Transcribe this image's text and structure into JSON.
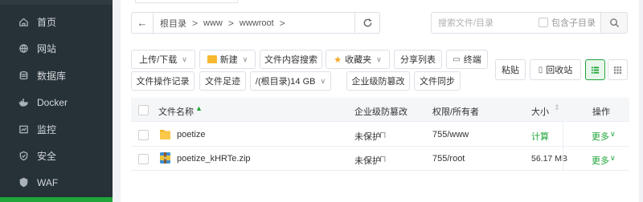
{
  "sidebar": {
    "items": [
      {
        "label": "首页",
        "icon": "home-icon"
      },
      {
        "label": "网站",
        "icon": "globe-icon"
      },
      {
        "label": "数据库",
        "icon": "database-icon"
      },
      {
        "label": "Docker",
        "icon": "docker-icon"
      },
      {
        "label": "监控",
        "icon": "monitor-icon"
      },
      {
        "label": "安全",
        "icon": "shield-icon"
      },
      {
        "label": "WAF",
        "icon": "waf-icon"
      }
    ],
    "active_color": "#20a53a",
    "bg_color": "#263238"
  },
  "pathbar": {
    "back": "←",
    "crumbs": [
      "根目录",
      "www",
      "wwwroot"
    ],
    "sep": ">"
  },
  "search": {
    "placeholder": "搜索文件/目录",
    "subdir_label": "包含子目录"
  },
  "toolbar": {
    "upload": "上传/下载",
    "new": "新建",
    "content_search": "文件内容搜索",
    "favorites": "收藏夹",
    "share_list": "分享列表",
    "terminal": "终端",
    "paste": "粘贴",
    "recycle": "回收站",
    "op_log": "文件操作记录",
    "footprint": "文件足迹",
    "disk": "/(根目录)14 GB",
    "tamper": "企业级防篡改",
    "sync": "文件同步"
  },
  "table": {
    "headers": {
      "name": "文件名称",
      "tamper": "企业级防篡改",
      "perm": "权限/所有者",
      "size": "大小",
      "ops": "操作"
    },
    "rows": [
      {
        "name": "poetize",
        "type": "folder",
        "tamper": "未保护",
        "perm": "755/www",
        "size": "计算",
        "more": "更多"
      },
      {
        "name": "poetize_kHRTe.zip",
        "type": "zip",
        "tamper": "未保护",
        "perm": "755/root",
        "size": "56.17 MB",
        "more": "更多"
      }
    ]
  },
  "colors": {
    "accent": "#20a53a",
    "folder": "#f5b82e",
    "star": "#f5a623"
  }
}
